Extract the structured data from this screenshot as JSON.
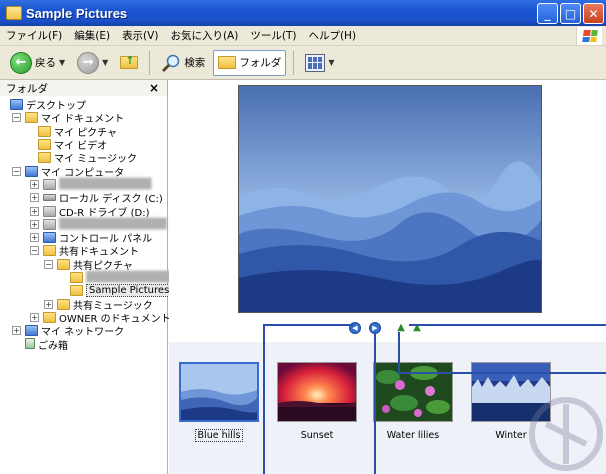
{
  "window": {
    "title": "Sample Pictures"
  },
  "menu": [
    "ファイル(F)",
    "編集(E)",
    "表示(V)",
    "お気に入り(A)",
    "ツール(T)",
    "ヘルプ(H)"
  ],
  "toolbar": {
    "back_label": "戻る",
    "search_label": "検索",
    "folders_label": "フォルダ"
  },
  "folders_pane": {
    "header": "フォルダ",
    "close_glyph": "×",
    "tree": [
      {
        "label": "デスクトップ",
        "level": 0
      },
      {
        "label": "マイ ドキュメント",
        "level": 1
      },
      {
        "label": "マイ ピクチャ",
        "level": 2
      },
      {
        "label": "マイ ビデオ",
        "level": 2
      },
      {
        "label": "マイ ミュージック",
        "level": 2
      },
      {
        "label": "マイ コンピュータ",
        "level": 1
      },
      {
        "label": "ローカル ディスク (C:)",
        "level": 2
      },
      {
        "label": "CD-R ドライブ (D:)",
        "level": 2
      },
      {
        "label": "コントロール パネル",
        "level": 2
      },
      {
        "label": "共有ドキュメント",
        "level": 2
      },
      {
        "label": "共有ピクチャ",
        "level": 3
      },
      {
        "label": "Sample Pictures",
        "level": 4
      },
      {
        "label": "共有ミュージック",
        "level": 3
      },
      {
        "label": "OWNER のドキュメント",
        "level": 2
      },
      {
        "label": "マイ ネットワーク",
        "level": 1
      },
      {
        "label": "ごみ箱",
        "level": 1
      }
    ]
  },
  "filmstrip": {
    "thumbnails": [
      {
        "caption": "Blue hills",
        "selected": true
      },
      {
        "caption": "Sunset",
        "selected": false
      },
      {
        "caption": "Water lilies",
        "selected": false
      },
      {
        "caption": "Winter",
        "selected": false
      }
    ]
  },
  "colors": {
    "titlebar": "#1a55d0",
    "callout": "#2a4fa8",
    "selection": "#3a6bd0"
  }
}
